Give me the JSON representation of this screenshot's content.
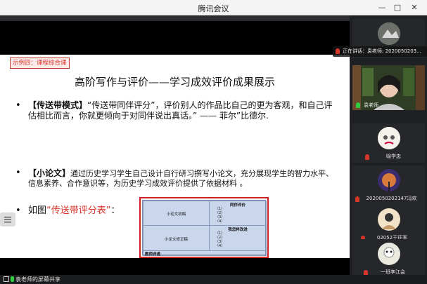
{
  "window": {
    "title": "腾讯会议"
  },
  "slide": {
    "tag": "示例四：课程综合课",
    "title": "高阶写作与评价——学习成效评价成果展示",
    "bullet1": {
      "label": "【传送带模式】",
      "text": "“传送带同伴评分”，评价别人的作品比自己的更为客观，和自己评估相比而言，你就更倾向于对同伴说出真话。” —— 菲尔”比德尔."
    },
    "bullet2": {
      "label": "【小论文】",
      "text": "通过历史学习学生自己设计自行研习撰写小论文，充分展现学生的智力水平、信息素养、合作意识等，为历史学习成效评价提供了依据材料 。"
    },
    "bullet3": {
      "prefix": "如图",
      "quote": "“传送带评分表”",
      "suffix": "："
    },
    "table": {
      "row1_label": "小论文初稿",
      "row1_header": "同伴评价",
      "row2_label": "小论文修正稿",
      "row2_header": "我怎样改进",
      "row3_label": "教师评语",
      "items": [
        "（1）",
        "（2）",
        "（3）",
        "（4）"
      ]
    }
  },
  "panel": {
    "speaking": "正在讲话：袁老师; 2020050203...",
    "participants": [
      {
        "name": ""
      },
      {
        "name": "袁老师"
      },
      {
        "name": "喻学忠"
      },
      {
        "name": "2020050202147冯欢"
      },
      {
        "name": "02052王征军"
      },
      {
        "name": "一班李江会"
      }
    ]
  },
  "bottom": {
    "share_label": "袁老师的屏幕共享"
  },
  "colors": {
    "accent_red": "#d9362b",
    "mic_green": "#2ecc40"
  }
}
